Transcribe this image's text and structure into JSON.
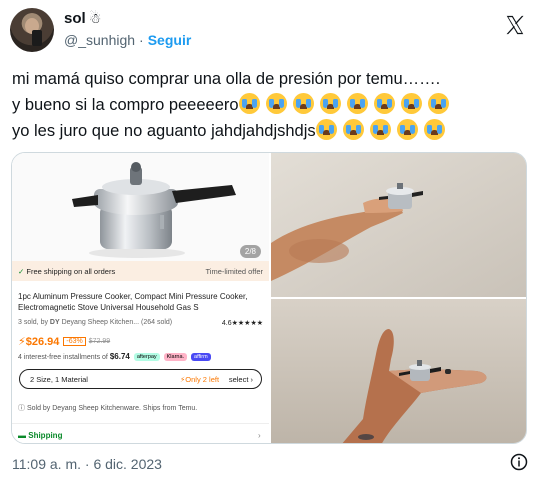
{
  "user": {
    "name": "sol",
    "name_emoji": "☃",
    "handle": "@_sunhigh",
    "separator": "·",
    "follow_label": "Seguir"
  },
  "tweet": {
    "line1": "mi mamá quiso comprar una olla de presión por temu…….",
    "line2": "y bueno si la compro peeeeero",
    "line3": "yo les juro que no aguanto  jahdjahdjshdjs",
    "line2_emoji_count": 8,
    "line3_emoji_count": 5
  },
  "product": {
    "image_count": "2/8",
    "shipping_label": "Free shipping on all orders",
    "shipping_check": "✓",
    "time_limited": "Time-limited offer",
    "title": "1pc Aluminum Pressure Cooker, Compact Mini Pressure Cooker, Electromagnetic Stove Universal Household Gas S",
    "sold_count": "3 sold, by",
    "seller": "Deyang Sheep Kitchen...",
    "sold_recent": "(264 sold)",
    "rating": "4.6★★★★★",
    "price": "$26.94",
    "discount": "-63%",
    "old_price": "$72.99",
    "installments": "4 interest-free installments of",
    "installment_amount": "$6.74",
    "pay1": "afterpay",
    "pay2": "Klarna.",
    "pay3": "affirm",
    "option": "2 Size, 1 Material",
    "stock": "Only 2 left",
    "select_label": "select",
    "sold_by": "Sold by Deyang Sheep Kitchenware. Ships from Temu.",
    "shipping_row": "Shipping"
  },
  "footer": {
    "time": "11:09 a. m. · 6 dic. 2023"
  },
  "colors": {
    "link": "#1d9bf0",
    "temu_orange": "#fb7701",
    "green": "#0a8a2a"
  }
}
